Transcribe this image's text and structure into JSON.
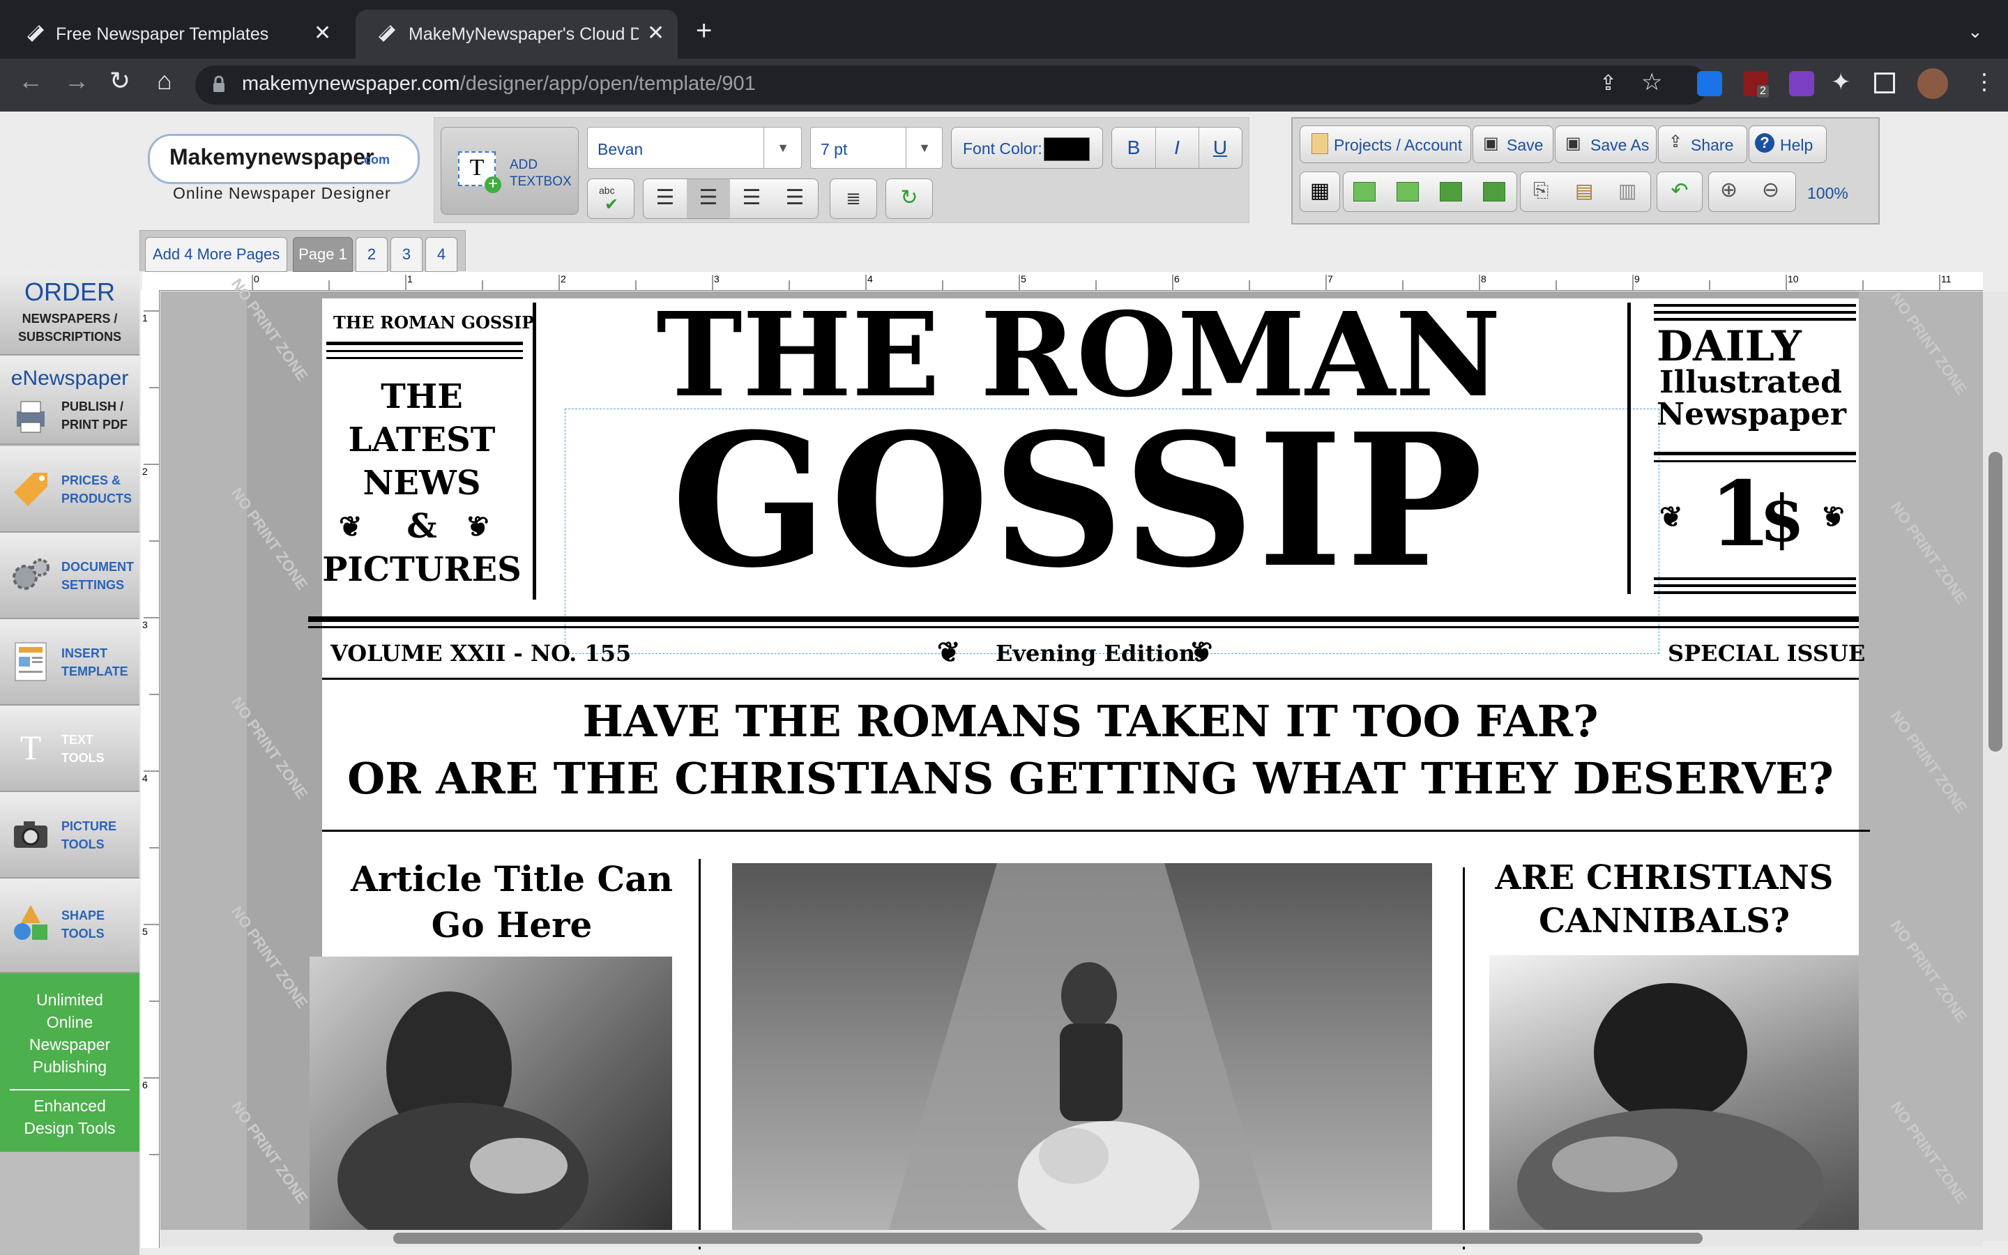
{
  "browser": {
    "tabs": [
      {
        "title": "Free Newspaper Templates",
        "active": false
      },
      {
        "title": "MakeMyNewspaper's Cloud De",
        "active": true
      }
    ],
    "url_host": "makemynewspaper.com",
    "url_path": "/designer/app/open/template/901",
    "extension_badge": "2"
  },
  "logo": {
    "brand": "Makemynewspaper",
    "brand_suffix": ".com",
    "tagline": "Online Newspaper Designer"
  },
  "toolbar": {
    "add_textbox": "ADD\nTEXTBOX",
    "font_family": "Bevan",
    "font_size": "7 pt",
    "font_color_label": "Font Color:",
    "font_color_value": "#000000",
    "bold": "B",
    "italic": "I",
    "underline": "U",
    "projects": "Projects / Account",
    "save": "Save",
    "save_as": "Save As",
    "share": "Share",
    "help": "Help",
    "zoom": "100%"
  },
  "pages": {
    "add_more": "Add 4 More Pages",
    "items": [
      "Page 1",
      "2",
      "3",
      "4"
    ]
  },
  "ruler": {
    "h_ticks": [
      "0",
      "1",
      "2",
      "3",
      "4",
      "5",
      "6",
      "7",
      "8",
      "9",
      "10",
      "11"
    ],
    "v_ticks": [
      "1",
      "2",
      "3",
      "4",
      "5",
      "6"
    ]
  },
  "sidebar": {
    "order_title": "ORDER",
    "order_sub": "NEWSPAPERS /\nSUBSCRIPTIONS",
    "enews_title": "eNewspaper",
    "enews_sub": "PUBLISH /\nPRINT PDF",
    "items": [
      {
        "label": "PRICES &\nPRODUCTS",
        "icon": "tag-icon"
      },
      {
        "label": "DOCUMENT\nSETTINGS",
        "icon": "gears-icon"
      },
      {
        "label": "INSERT\nTEMPLATE",
        "icon": "template-icon"
      },
      {
        "label": "TEXT\nTOOLS",
        "icon": "text-icon"
      },
      {
        "label": "PICTURE\nTOOLS",
        "icon": "camera-icon"
      },
      {
        "label": "SHAPE\nTOOLS",
        "icon": "shapes-icon"
      }
    ],
    "green_line1": "Unlimited\nOnline\nNewspaper\nPublishing",
    "green_line2": "Enhanced\nDesign Tools"
  },
  "newspaper": {
    "corner_title": "THE ROMAN GOSSIP",
    "left_box": [
      "THE",
      "LATEST",
      "NEWS",
      "&",
      "PICTURES"
    ],
    "masthead_top": "THE ROMAN",
    "masthead_main": "GOSSIP",
    "right_box": [
      "DAILY",
      "Illustrated",
      "Newspaper"
    ],
    "price": "1",
    "price_symbol": "$",
    "volume": "VOLUME XXII - NO. 155",
    "edition": "Evening Edition",
    "special": "SPECIAL ISSUE",
    "headline_1": "HAVE THE ROMANS TAKEN IT TOO FAR?",
    "headline_2": "OR ARE THE CHRISTIANS GETTING WHAT THEY DESERVE?",
    "article_left_title": "Article Title Can\nGo Here",
    "article_right_title": "ARE CHRISTIANS\nCANNIBALS?",
    "watermark": "NO PRINT ZONE"
  }
}
